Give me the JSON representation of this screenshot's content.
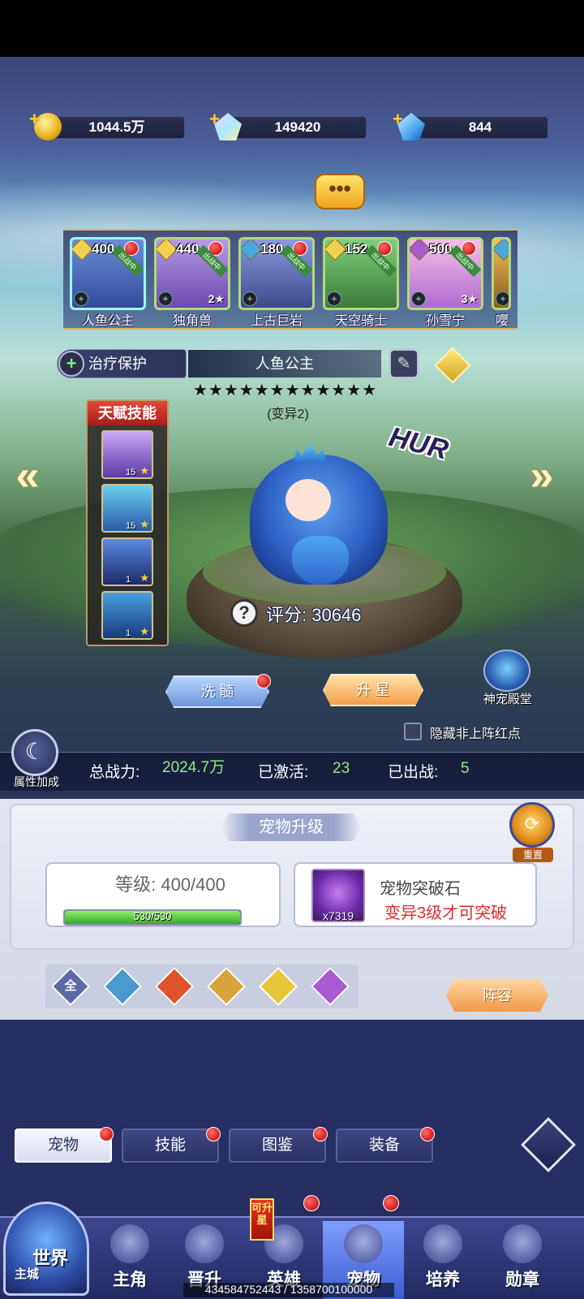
{
  "currency": {
    "gold": "1044.5万",
    "crystal": "149420",
    "diamond": "844",
    "icons": [
      "gold-coin-icon",
      "crystal-icon",
      "diamond-icon"
    ]
  },
  "pets": [
    {
      "level": "400",
      "name": "人鱼公主",
      "stars": "",
      "tag": "出战中",
      "element": "light",
      "selected": true
    },
    {
      "level": "440",
      "name": "独角兽",
      "stars": "2",
      "tag": "出战中",
      "element": "light",
      "selected": false
    },
    {
      "level": "180",
      "name": "上古巨岩",
      "stars": "",
      "tag": "出战中",
      "element": "water",
      "selected": false
    },
    {
      "level": "152",
      "name": "天空骑士",
      "stars": "",
      "tag": "出战中",
      "element": "light",
      "selected": false
    },
    {
      "level": "500",
      "name": "孙雪宁",
      "stars": "3",
      "tag": "出战中",
      "element": "dark",
      "selected": false
    },
    {
      "level": "",
      "name": "嚶",
      "stars": "",
      "tag": "",
      "element": "water",
      "selected": false
    }
  ],
  "selected_pet": {
    "type_label": "治疗保护",
    "name": "人鱼公主",
    "stars": "★★★★★★★★★★★★",
    "mutation": "(变异2)",
    "rarity_badge": "HUR",
    "score_label": "评分: 30646"
  },
  "talent": {
    "title": "天赋技能",
    "skills": [
      {
        "level": "15",
        "badge": "★"
      },
      {
        "level": "15",
        "badge": "★"
      },
      {
        "level": "1",
        "badge": "★"
      },
      {
        "level": "1",
        "badge": "★"
      }
    ]
  },
  "actions": {
    "wash": "洗 髓",
    "upstar": "升 星",
    "hall": "神宠殿堂",
    "hide_label": "隐藏非上阵红点",
    "attr_bonus": "属性加成"
  },
  "stats": {
    "power_label": "总战力:",
    "power_value": "2024.7万",
    "activated_label": "已激活:",
    "activated_value": "23",
    "deployed_label": "已出战:",
    "deployed_value": "5"
  },
  "upgrade": {
    "title": "宠物升级",
    "reset": "重置",
    "level_label": "等级:  400/400",
    "exp_text": "530/530",
    "exp_fraction": 1.0,
    "stone_name": "宠物突破石",
    "stone_count": "x7319",
    "stone_requirement": "变异3级才可突破"
  },
  "filters": {
    "all": "全",
    "items": [
      "water-element-icon",
      "fire-element-icon",
      "earth-element-icon",
      "light-element-icon",
      "dark-element-icon"
    ],
    "colors": [
      "#5a6aa8",
      "#4a9ad0",
      "#e0522a",
      "#d9a23a",
      "#e8c63a",
      "#a85ad0"
    ],
    "lineup": "阵容"
  },
  "subtabs": [
    "宠物",
    "技能",
    "图鉴",
    "装备"
  ],
  "nav": {
    "world": "世界",
    "world_sub": "主城",
    "can_star": "可升星",
    "items": [
      "主角",
      "晋升",
      "英雄",
      "宠物",
      "培养",
      "勋章"
    ]
  },
  "debug": "434584752443 / 1358700100000"
}
